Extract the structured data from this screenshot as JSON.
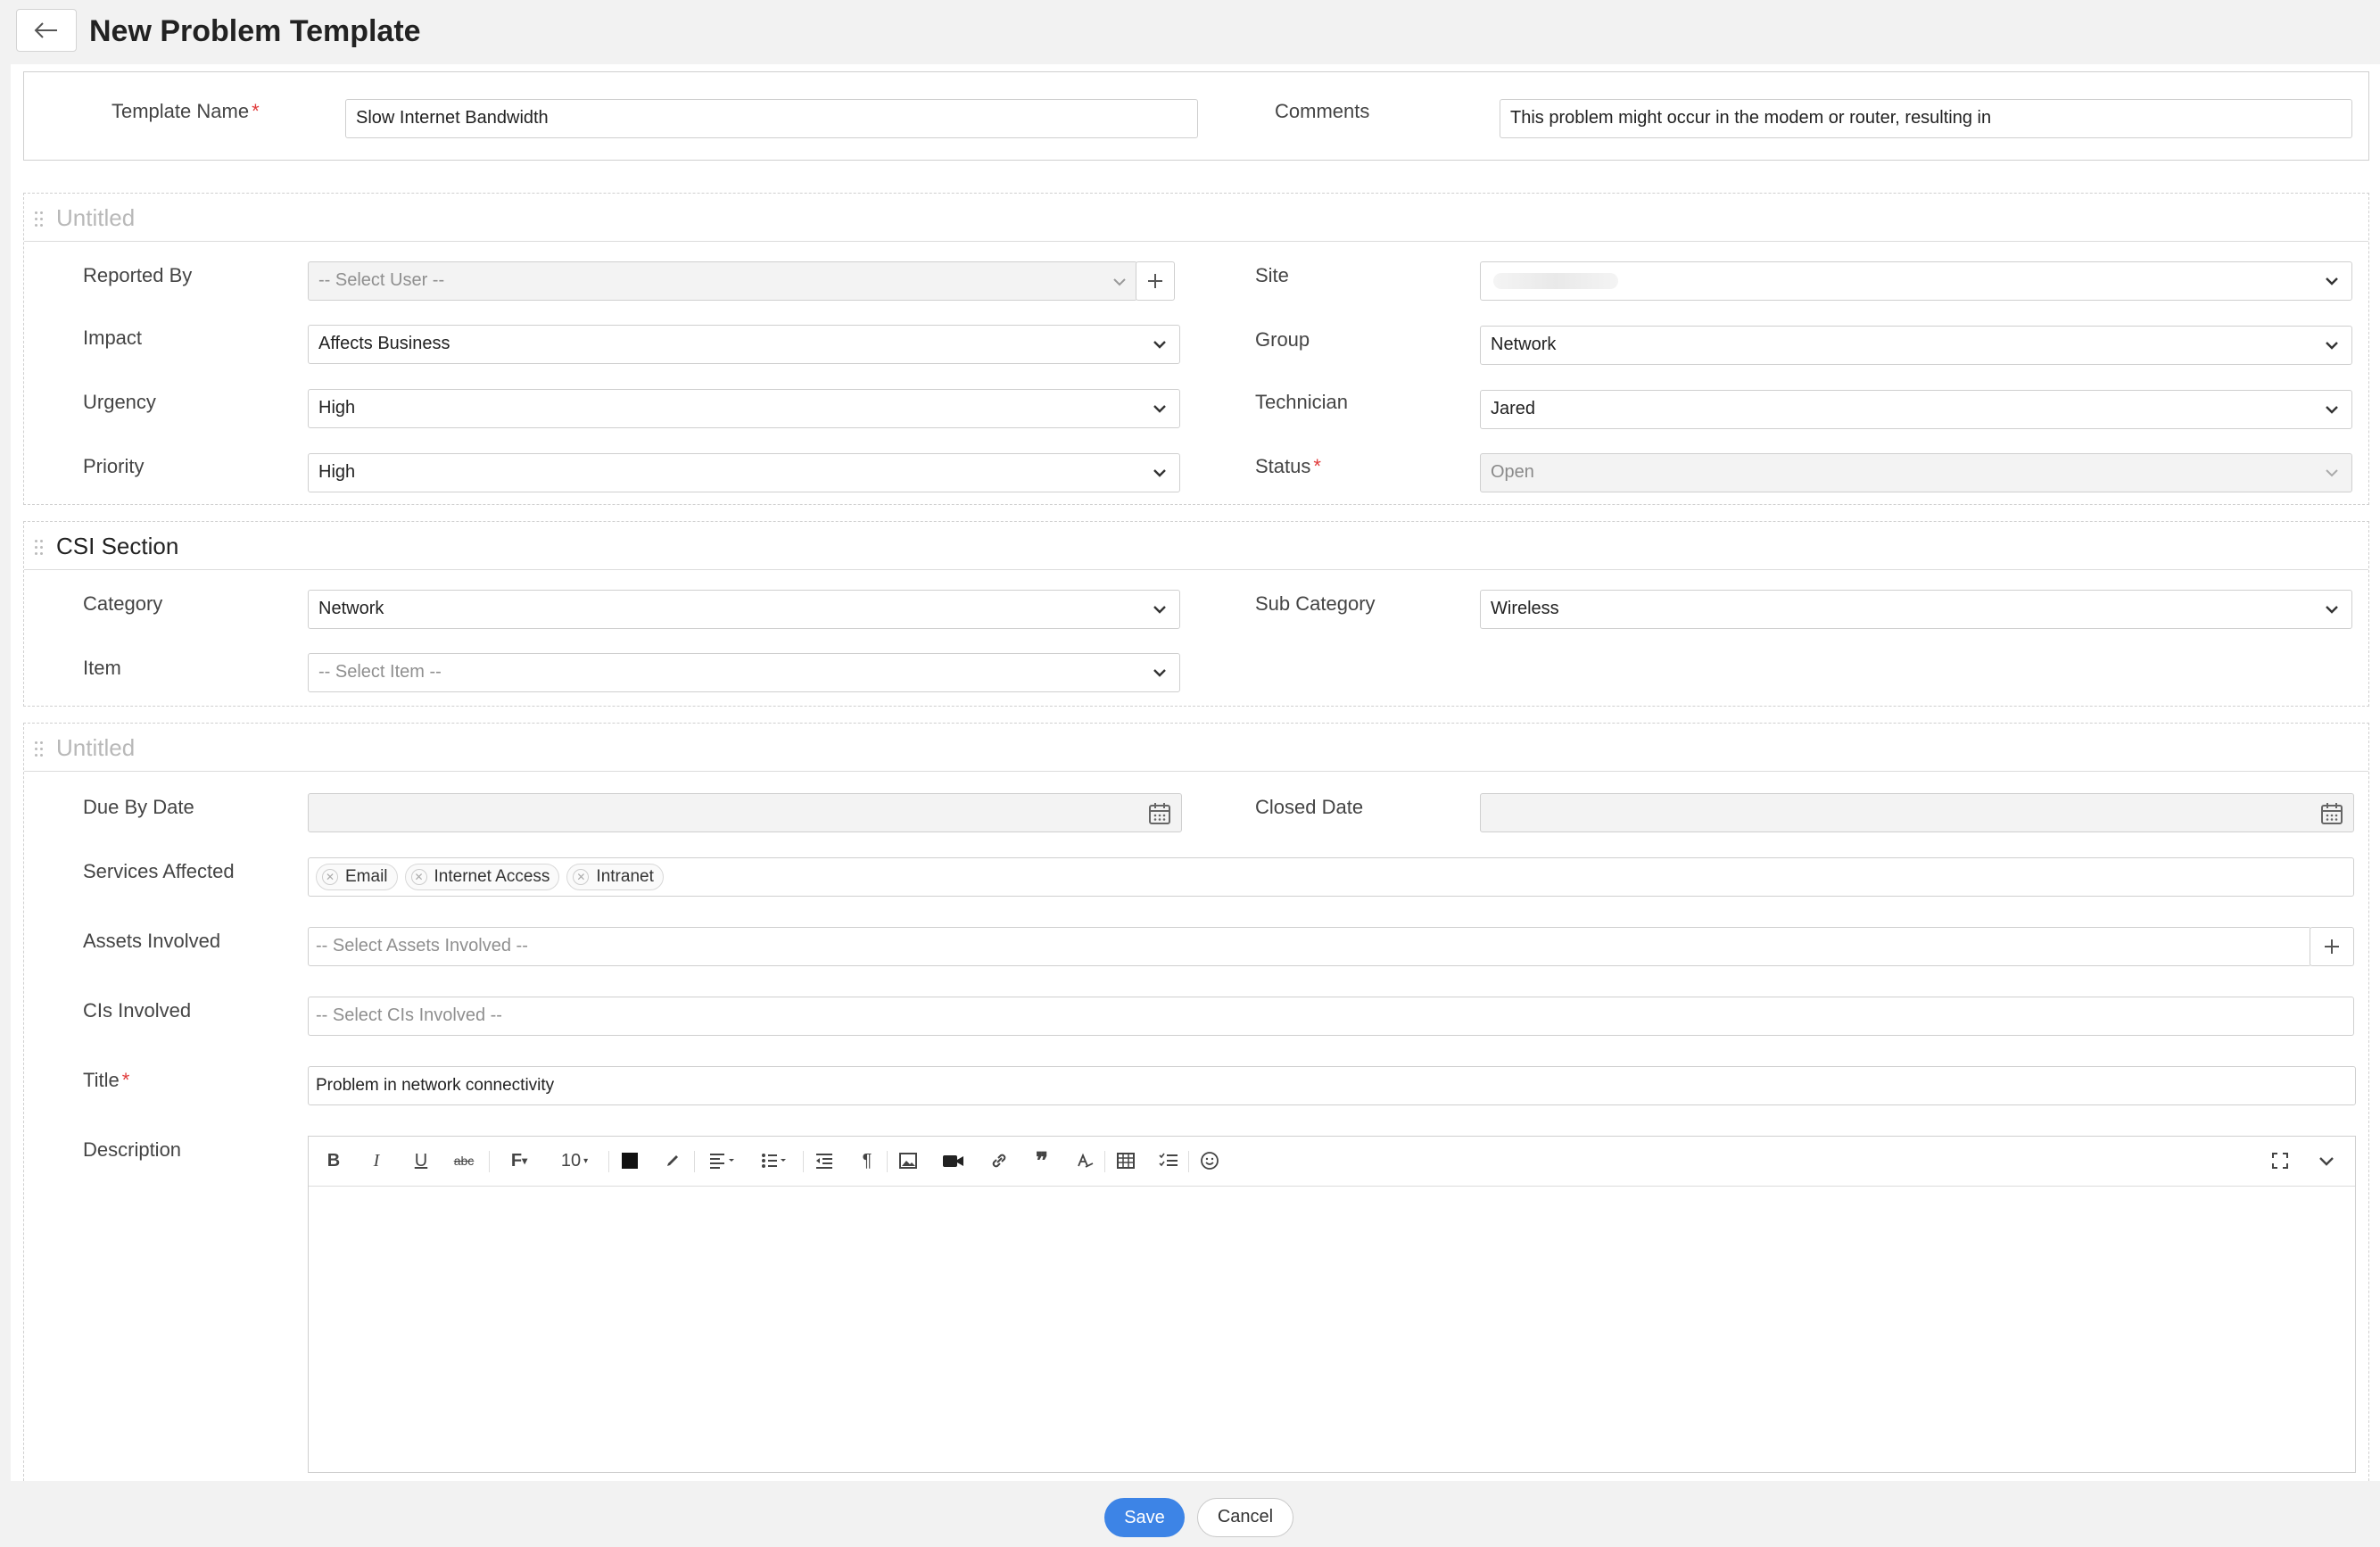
{
  "header": {
    "title": "New Problem Template"
  },
  "template": {
    "name_label": "Template Name",
    "name_value": "Slow Internet Bandwidth",
    "comments_label": "Comments",
    "comments_value": "This problem might occur in the modem or router, resulting in"
  },
  "section1": {
    "title": "Untitled",
    "reported_by": {
      "label": "Reported By",
      "placeholder": "-- Select User --"
    },
    "site": {
      "label": "Site",
      "value": ""
    },
    "impact": {
      "label": "Impact",
      "value": "Affects Business"
    },
    "group": {
      "label": "Group",
      "value": "Network"
    },
    "urgency": {
      "label": "Urgency",
      "value": "High"
    },
    "technician": {
      "label": "Technician",
      "value": "Jared"
    },
    "priority": {
      "label": "Priority",
      "value": "High"
    },
    "status": {
      "label": "Status",
      "value": "Open"
    }
  },
  "section2": {
    "title": "CSI Section",
    "category": {
      "label": "Category",
      "value": "Network"
    },
    "sub_category": {
      "label": "Sub Category",
      "value": "Wireless"
    },
    "item": {
      "label": "Item",
      "placeholder": "-- Select Item --"
    }
  },
  "section3": {
    "title": "Untitled",
    "due_by_date": {
      "label": "Due By Date",
      "value": ""
    },
    "closed_date": {
      "label": "Closed Date",
      "value": ""
    },
    "services_affected": {
      "label": "Services Affected",
      "tags": [
        "Email",
        "Internet Access",
        "Intranet"
      ]
    },
    "assets_involved": {
      "label": "Assets Involved",
      "placeholder": "-- Select Assets Involved  --"
    },
    "cis_involved": {
      "label": "CIs Involved",
      "placeholder": "-- Select CIs Involved  --"
    },
    "title_field": {
      "label": "Title",
      "value": "Problem in network connectivity"
    },
    "description": {
      "label": "Description",
      "font_size": "10"
    }
  },
  "footer": {
    "save_label": "Save",
    "cancel_label": "Cancel"
  },
  "colors": {
    "primary": "#3d84e6",
    "required": "#e03a3a"
  }
}
